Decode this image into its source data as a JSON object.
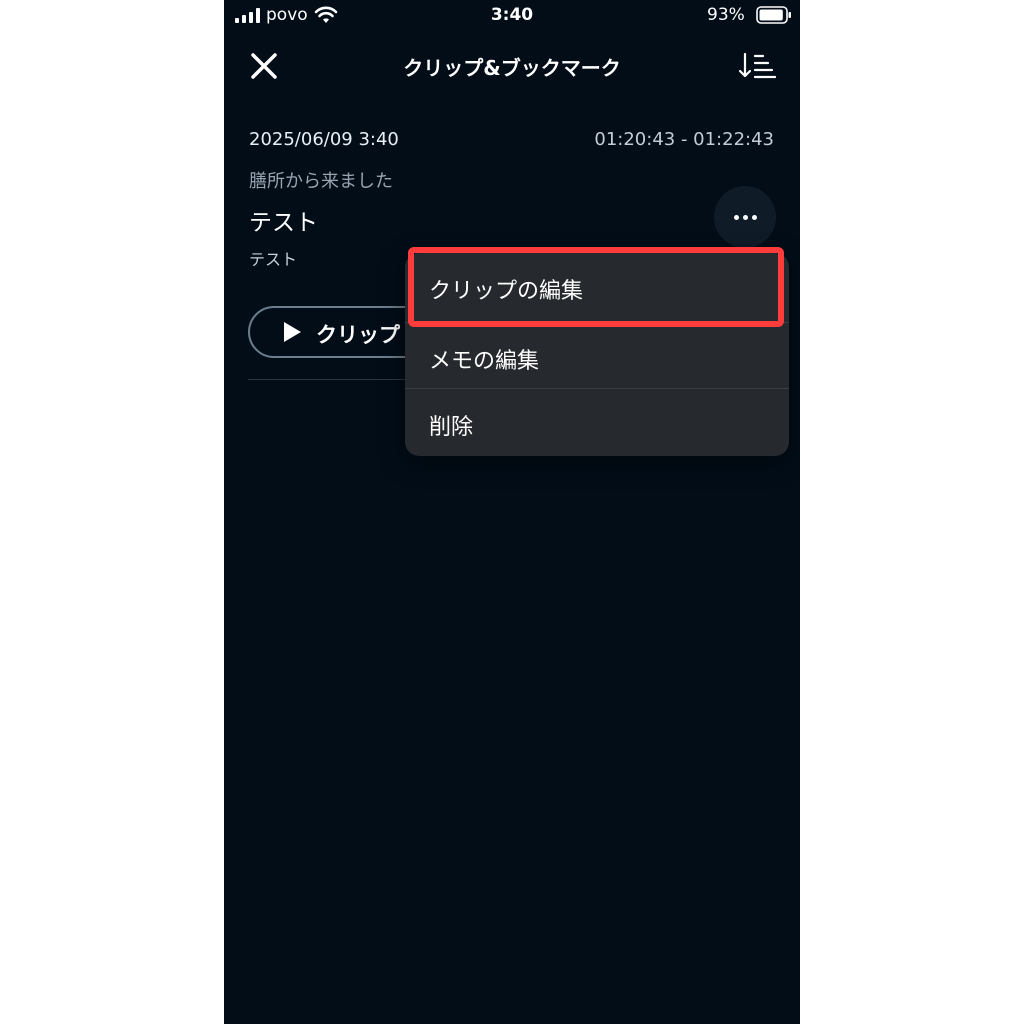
{
  "status_bar": {
    "carrier": "povo",
    "time": "3:40",
    "battery_percent": "93%",
    "battery_level": 0.93
  },
  "nav": {
    "title": "クリップ&ブックマーク",
    "close_icon": "close-icon",
    "sort_icon": "sort-icon"
  },
  "entry": {
    "date": "2025/06/09 3:40",
    "time_range": "01:20:43 - 01:22:43",
    "subtitle": "膳所から来ました",
    "title": "テスト",
    "memo": "テスト",
    "more_icon": "more-horizontal-icon",
    "play_button_label": "クリップ"
  },
  "menu": {
    "items": [
      {
        "label": "クリップの編集",
        "highlighted": true
      },
      {
        "label": "メモの編集"
      },
      {
        "label": "削除"
      }
    ]
  },
  "colors": {
    "background": "#020d18",
    "menu_background": "#262a2e",
    "highlight": "#ff3b3b"
  }
}
